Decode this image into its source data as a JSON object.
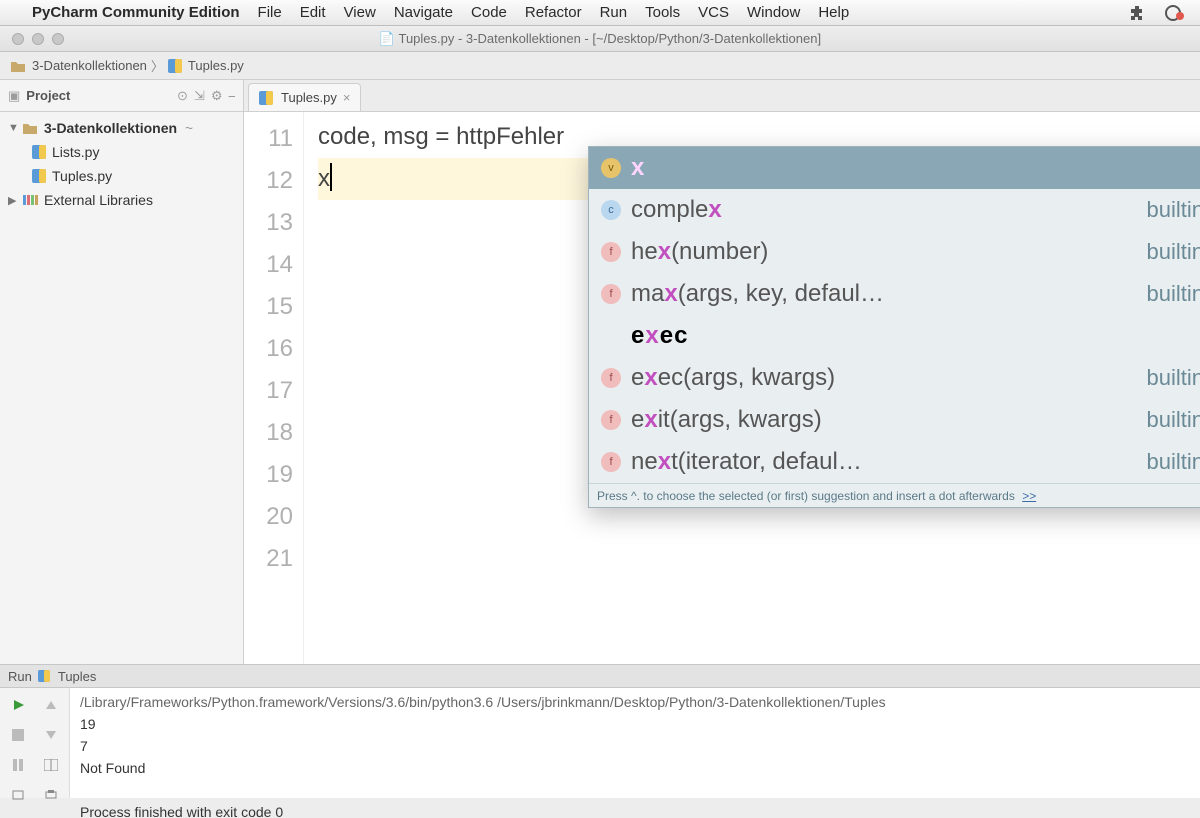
{
  "mac_menu": {
    "app_name": "PyCharm Community Edition",
    "items": [
      "File",
      "Edit",
      "View",
      "Navigate",
      "Code",
      "Refactor",
      "Run",
      "Tools",
      "VCS",
      "Window",
      "Help"
    ]
  },
  "window_title": "Tuples.py - 3-Datenkollektionen - [~/Desktop/Python/3-Datenkollektionen]",
  "breadcrumb": {
    "project": "3-Datenkollektionen",
    "file": "Tuples.py"
  },
  "project_tool": {
    "title": "Project",
    "root": "3-Datenkollektionen",
    "files": [
      "Lists.py",
      "Tuples.py"
    ],
    "libs": "External Libraries"
  },
  "tab": {
    "label": "Tuples.py"
  },
  "editor": {
    "first_line_num": 11,
    "last_line_num": 21,
    "line11": "code, msg = httpFehler",
    "current": "x"
  },
  "completion": {
    "query": "x",
    "rows": [
      {
        "kind": "v",
        "prefix": "",
        "match": "x",
        "suffix": "",
        "right": "",
        "selected": true
      },
      {
        "kind": "c",
        "prefix": "comple",
        "match": "x",
        "suffix": "",
        "right": "builtins",
        "selected": false
      },
      {
        "kind": "f",
        "prefix": "he",
        "match": "x",
        "suffix": "(number)",
        "right": "builtins",
        "selected": false
      },
      {
        "kind": "f",
        "prefix": "ma",
        "match": "x",
        "suffix": "(args, key, defaul…",
        "right": "builtins",
        "selected": false
      },
      {
        "kind": "",
        "prefix": "e",
        "match": "x",
        "suffix": "ec",
        "right": "",
        "selected": false,
        "keyword": true
      },
      {
        "kind": "f",
        "prefix": "e",
        "match": "x",
        "suffix": "ec(args, kwargs)",
        "right": "builtins",
        "selected": false
      },
      {
        "kind": "f",
        "prefix": "e",
        "match": "x",
        "suffix": "it(args, kwargs)",
        "right": "builtins",
        "selected": false
      },
      {
        "kind": "f",
        "prefix": "ne",
        "match": "x",
        "suffix": "t(iterator, defaul…",
        "right": "builtins",
        "selected": false
      }
    ],
    "footer": "Press ^. to choose the selected (or first) suggestion and insert a dot afterwards",
    "footer_link": ">>"
  },
  "run": {
    "header_prefix": "Run",
    "config_name": "Tuples",
    "output": {
      "cmd": "/Library/Frameworks/Python.framework/Versions/3.6/bin/python3.6 /Users/jbrinkmann/Desktop/Python/3-Datenkollektionen/Tuples",
      "l1": "19",
      "l2": "7",
      "l3": "Not Found",
      "l4": "",
      "l5": "Process finished with exit code 0"
    }
  }
}
